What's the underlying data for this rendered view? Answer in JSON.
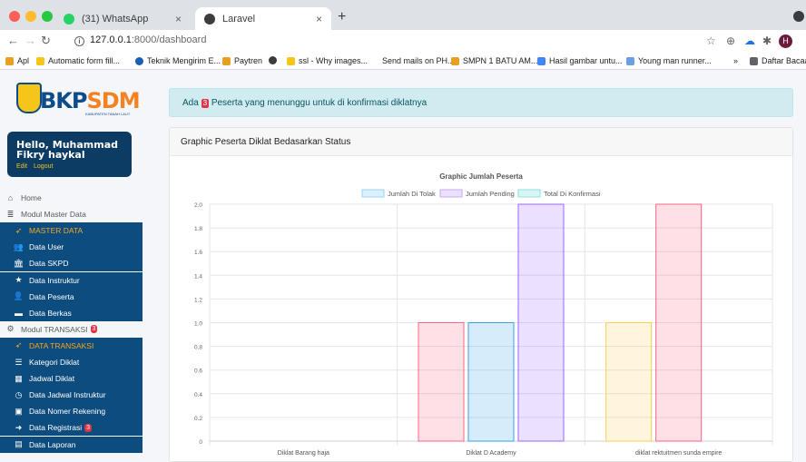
{
  "browser": {
    "tabs": [
      {
        "title": "(31) WhatsApp",
        "close": "×"
      },
      {
        "title": "Laravel",
        "close": "×"
      }
    ],
    "new_tab": "+",
    "url_host": "127.0.0.1",
    "url_rest": ":8000/dashboard",
    "avatar_letter": "H",
    "bookmarks": [
      {
        "label": "Apl",
        "color": "#e8a020"
      },
      {
        "label": "Automatic form fill...",
        "color": "#f5c518"
      },
      {
        "label": "Teknik Mengirim E...",
        "color": "#1a5fb4"
      },
      {
        "label": "Paytren",
        "color": "#e8a020"
      },
      {
        "label": "ssl - Why images...",
        "color": "#f5c518"
      },
      {
        "label": "Send mails on PH...",
        "color": "#ffffff"
      },
      {
        "label": "SMPN 1 BATU AM...",
        "color": "#e8a020"
      },
      {
        "label": "Hasil gambar untu...",
        "color": "#4285f4"
      },
      {
        "label": "Young man runner...",
        "color": "#6aa0e0"
      },
      {
        "label": "»",
        "color": ""
      },
      {
        "label": "Daftar Bacaan",
        "color": "#5f6368"
      }
    ]
  },
  "sidebar": {
    "logo_text_a": "BKP",
    "logo_text_b": "SDM",
    "logo_sub": "KABUPATEN TANAH LAUT",
    "user_name": "Hello, Muhammad Fikry haykal",
    "user_edit": "Edit",
    "user_logout": "Logout",
    "items": [
      {
        "label": "Home",
        "icon": "home-icon",
        "glyph": "⌂",
        "style": "plain"
      },
      {
        "label": "Modul Master Data",
        "icon": "database-icon",
        "glyph": "≣",
        "style": "plain"
      },
      {
        "label": "MASTER DATA",
        "icon": "rocket-icon",
        "glyph": "➶",
        "style": "header"
      },
      {
        "label": "Data User",
        "icon": "users-icon",
        "glyph": "👥",
        "style": "dark"
      },
      {
        "label": "Data SKPD",
        "icon": "institution-icon",
        "glyph": "🏛",
        "style": "dark"
      },
      {
        "label": "Data Instruktur",
        "icon": "star-icon",
        "glyph": "★",
        "style": "dark"
      },
      {
        "label": "Data Peserta",
        "icon": "user-icon",
        "glyph": "👤",
        "style": "dark"
      },
      {
        "label": "Data Berkas",
        "icon": "folder-icon",
        "glyph": "▬",
        "style": "dark"
      },
      {
        "label": "Modul TRANSAKSI",
        "icon": "cart-icon",
        "glyph": "⚙",
        "style": "plain",
        "badge": "3"
      },
      {
        "label": "DATA TRANSAKSI",
        "icon": "rocket-icon",
        "glyph": "➶",
        "style": "header"
      },
      {
        "label": "Kategori Diklat",
        "icon": "list-icon",
        "glyph": "☰",
        "style": "dark"
      },
      {
        "label": "Jadwal Diklat",
        "icon": "calendar-icon",
        "glyph": "▦",
        "style": "dark"
      },
      {
        "label": "Data Jadwal Instruktur",
        "icon": "clock-icon",
        "glyph": "◷",
        "style": "dark"
      },
      {
        "label": "Data Nomer Rekening",
        "icon": "money-icon",
        "glyph": "▣",
        "style": "dark"
      },
      {
        "label": "Data Registrasi",
        "icon": "sign-in-icon",
        "glyph": "➜",
        "style": "dark",
        "badge": "3"
      },
      {
        "label": "Data Laporan",
        "icon": "file-icon",
        "glyph": "▤",
        "style": "dark"
      }
    ]
  },
  "alert": {
    "prefix": "Ada",
    "count": "3",
    "suffix": "Peserta yang menunggu untuk di konfirmasi diklatnya"
  },
  "card": {
    "title": "Graphic Peserta Diklat Bedasarkan Status"
  },
  "colors": {
    "tolak": "#9ad0f5",
    "pending": "#c9a8f5",
    "konfirmasi": "#8ee0df",
    "pink": "#ff6384",
    "yellow": "#ffcd56",
    "blue": "#36a2eb",
    "purple": "#9966ff"
  },
  "chart_data": {
    "type": "bar",
    "title": "Graphic Jumlah Peserta",
    "categories": [
      "Diklat Barang haja",
      "Diklat D Academy",
      "diklat rektuitmen sunda empire"
    ],
    "ylim": [
      0,
      2.0
    ],
    "yticks": [
      "0",
      "0.2",
      "0.4",
      "0.6",
      "0.8",
      "1.0",
      "1.2",
      "1.4",
      "1.6",
      "1.8",
      "2.0"
    ],
    "legend_position": "top",
    "grid": true,
    "series": [
      {
        "name": "Jumlah Di Tolak",
        "values": [
          0,
          1,
          1
        ],
        "colors": [
          "#ff6384",
          "#ff6384",
          "#ffcd56"
        ]
      },
      {
        "name": "Jumlah Pending",
        "values": [
          0,
          1,
          2
        ],
        "colors": [
          "#36a2eb",
          "#36a2eb",
          "#ff6384"
        ]
      },
      {
        "name": "Total Di Konfirmasi",
        "values": [
          0,
          2,
          0
        ],
        "colors": [
          "#9966ff",
          "#9966ff",
          "#9966ff"
        ]
      }
    ]
  }
}
